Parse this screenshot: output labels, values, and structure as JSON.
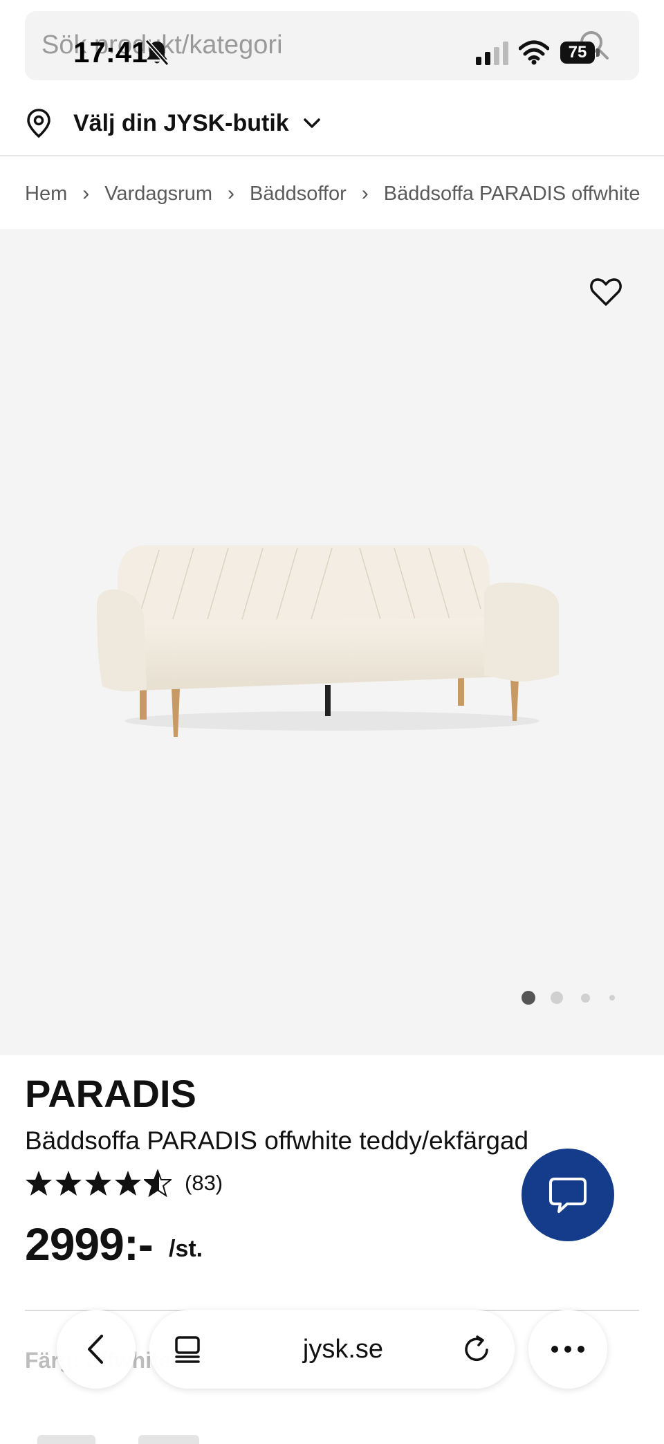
{
  "status_bar": {
    "time": "17:41",
    "battery": "75"
  },
  "search": {
    "placeholder": "Sök produkt/kategori"
  },
  "store": {
    "label": "Välj din JYSK-butik"
  },
  "breadcrumb": {
    "items": [
      "Hem",
      "Vardagsrum",
      "Bäddsoffor",
      "Bäddsoffa PARADIS offwhite teddy/ekfärgad"
    ],
    "separator": "›"
  },
  "gallery": {
    "image_count": 4,
    "active_index": 0
  },
  "product": {
    "brand": "PARADIS",
    "name": "Bäddsoffa PARADIS offwhite teddy/ekfärgad",
    "rating": 4.5,
    "review_count": "(83)",
    "price": "2999:-",
    "price_unit": "/st.",
    "color_label": "Färg: offwhite"
  },
  "browser": {
    "url": "jysk.se"
  },
  "colors": {
    "chat_button": "#143c8a",
    "image_bg": "#f4f4f4",
    "sofa": "#f2ece2",
    "legs": "#c79a63"
  },
  "icons": [
    "search-icon",
    "bell-slash-icon",
    "signal-icon",
    "wifi-icon",
    "map-pin-icon",
    "chevron-down-icon",
    "heart-icon",
    "star-icon",
    "chat-icon",
    "chevron-left-icon",
    "tabs-icon",
    "reload-icon",
    "more-icon"
  ]
}
